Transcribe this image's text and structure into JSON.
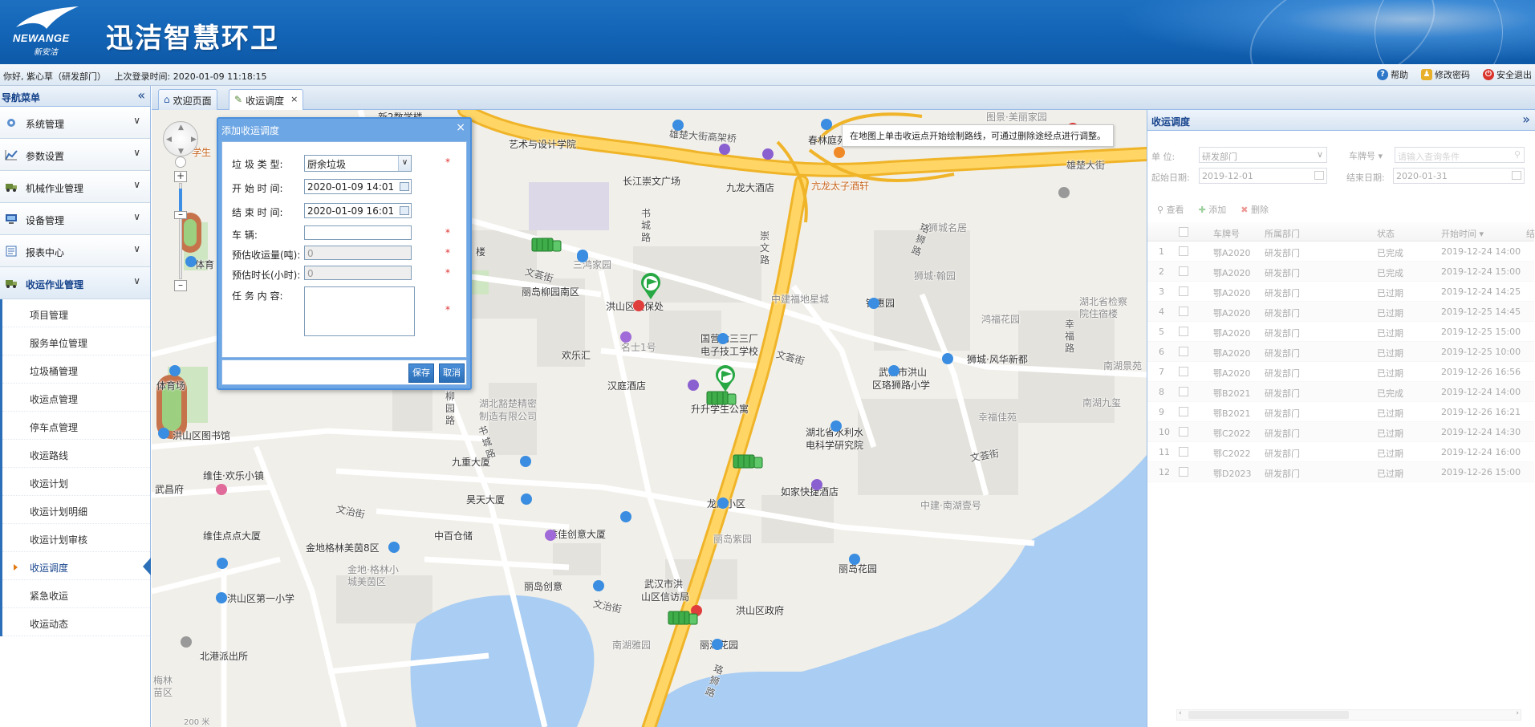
{
  "app": {
    "logo_en": "NEWANGE",
    "logo_cn": "新安洁",
    "title": "迅洁智慧环卫"
  },
  "infobar": {
    "welcome": "你好,",
    "user": "紫心草（研发部门）",
    "last_login_label": "上次登录时间:",
    "last_login_time": "2020-01-09 11:18:15",
    "help": "帮助",
    "change_password": "修改密码",
    "logout": "安全退出"
  },
  "sidebar": {
    "title": "导航菜单",
    "groups": [
      {
        "label": "系统管理",
        "icon": "gear-icon"
      },
      {
        "label": "参数设置",
        "icon": "chart-icon"
      },
      {
        "label": "机械作业管理",
        "icon": "truck-icon"
      },
      {
        "label": "设备管理",
        "icon": "monitor-icon"
      },
      {
        "label": "报表中心",
        "icon": "report-icon"
      },
      {
        "label": "收运作业管理",
        "icon": "truck-icon"
      }
    ],
    "subitems": [
      "项目管理",
      "服务单位管理",
      "垃圾桶管理",
      "收运点管理",
      "停车点管理",
      "收运路线",
      "收运计划",
      "收运计划明细",
      "收运计划审核",
      "收运调度",
      "紧急收运",
      "收运动态"
    ],
    "current_subitem": "收运调度"
  },
  "tabs": [
    {
      "label": "欢迎页面",
      "icon": "home-icon"
    },
    {
      "label": "收运调度",
      "icon": "dispatch-icon",
      "closable": true
    }
  ],
  "map": {
    "hint": "在地图上单击收运点开始绘制路线，可通过删除途经点进行调整。",
    "labels": {
      "l1": "新2数学楼",
      "l2": "艺术与设计学院",
      "l3": "雄楚大街高架桥",
      "l4": "春林庭苑",
      "l5": "长江崇文广场",
      "l6": "九龙大酒店",
      "l7": "亢龙太子酒轩",
      "l8": "雄楚大街",
      "l9": "学生",
      "l10": "书城路",
      "l11": "三鸿家园",
      "l12": "文荟街",
      "l13": "丽岛柳园南区",
      "l14": "洪山区社保处",
      "l15": "崇文路",
      "l16": "中建福地星城",
      "l17": "狮城名居",
      "l18": "狮城·翰园",
      "l19": "锦惠园",
      "l20": "鸿福花园",
      "l21": "湖北省检察院住宿楼",
      "l22": "幸福路",
      "l23": "欢乐汇",
      "l24": "名士1号",
      "l25": "国营七三三厂",
      "l26": "电子技工学校",
      "l27": "文荟街",
      "l28": "武汉市洪山",
      "l29": "区珞狮路小学",
      "l30": "狮城·风华新都",
      "l31": "汉庭酒店",
      "l32": "升升学生公寓",
      "l33": "湖北豁楚精密",
      "l34": "制造有限公司",
      "l35": "湖北省水利水",
      "l36": "电科学研究院",
      "l37": "南湖九玺",
      "l38": "幸福佳苑",
      "l39": "南湖景苑",
      "l40": "九重大厦",
      "l41": "昊天大厦",
      "l42": "龙威小区",
      "l43": "如家快捷酒店",
      "l44": "中建·南湖壹号",
      "l45": "文荟街",
      "l46": "洪山区图书馆",
      "l47": "维佳·欢乐小镇",
      "l48": "武昌府",
      "l49": "文治街",
      "l50": "维佳点点大厦",
      "l51": "金地格林美茵8区",
      "l52": "金地·格林小城美茵区",
      "l53": "中百仓储",
      "l54": "维佳创意大厦",
      "l55": "丽岛紫园",
      "l56": "丽岛花园",
      "l57": "洪山区第一小学",
      "l58": "丽岛创意",
      "l59": "武汉市洪",
      "l60": "山区信访局",
      "l61": "洪山区政府",
      "l62": "文治街",
      "l63": "南湖雅园",
      "l64": "丽湖花园",
      "l65": "北港派出所",
      "l66": "体育",
      "l67": "体育场",
      "l68": "柳园路",
      "l69": "书城路",
      "l70": "珞狮路",
      "l71": "珞狮路",
      "l72": "梅林苗区",
      "l73": "图景·美丽家园",
      "l74": "楼",
      "l75": "雄楚大街"
    }
  },
  "dialog": {
    "title": "添加收运调度",
    "fields": [
      {
        "label": "垃  圾  类  型:",
        "value": "厨余垃圾",
        "type": "select"
      },
      {
        "label": "开  始  时  间:",
        "value": "2020-01-09 14:01",
        "type": "date"
      },
      {
        "label": "结  束  时  间:",
        "value": "2020-01-09 16:01",
        "type": "date"
      },
      {
        "label": "车            辆:",
        "value": "",
        "type": "text"
      },
      {
        "label": "预估收运量(吨):",
        "value": "0",
        "type": "disabled"
      },
      {
        "label": "预估时长(小时):",
        "value": "0",
        "type": "disabled"
      },
      {
        "label": "任  务  内  容:",
        "value": "",
        "type": "textarea"
      }
    ],
    "required_mark": "*",
    "save": "保存",
    "cancel": "取消"
  },
  "rpanel": {
    "title": "收运调度",
    "dept_label": "单    位:",
    "dept_value": "研发部门",
    "plate_select": "车牌号",
    "plate_placeholder": "请输入查询条件",
    "start_label": "起始日期:",
    "start_value": "2019-12-01",
    "end_label": "结束日期:",
    "end_value": "2020-01-31",
    "tb_view": "查看",
    "tb_add": "添加",
    "tb_delete": "删除",
    "columns": [
      "车牌号",
      "所属部门",
      "状态",
      "开始时间"
    ],
    "col_extra": "结",
    "rows": [
      {
        "n": "1",
        "plate": "鄂A2020",
        "dept": "研发部门",
        "status": "已完成",
        "start": "2019-12-24 14:00"
      },
      {
        "n": "2",
        "plate": "鄂A2020",
        "dept": "研发部门",
        "status": "已完成",
        "start": "2019-12-24 15:00"
      },
      {
        "n": "3",
        "plate": "鄂A2020",
        "dept": "研发部门",
        "status": "已过期",
        "start": "2019-12-24 14:25"
      },
      {
        "n": "4",
        "plate": "鄂A2020",
        "dept": "研发部门",
        "status": "已过期",
        "start": "2019-12-25 14:45"
      },
      {
        "n": "5",
        "plate": "鄂A2020",
        "dept": "研发部门",
        "status": "已过期",
        "start": "2019-12-25 15:00"
      },
      {
        "n": "6",
        "plate": "鄂A2020",
        "dept": "研发部门",
        "status": "已过期",
        "start": "2019-12-25 10:00"
      },
      {
        "n": "7",
        "plate": "鄂A2020",
        "dept": "研发部门",
        "status": "已过期",
        "start": "2019-12-26 16:56"
      },
      {
        "n": "8",
        "plate": "鄂B2021",
        "dept": "研发部门",
        "status": "已完成",
        "start": "2019-12-24 14:00"
      },
      {
        "n": "9",
        "plate": "鄂B2021",
        "dept": "研发部门",
        "status": "已过期",
        "start": "2019-12-26 16:21"
      },
      {
        "n": "10",
        "plate": "鄂C2022",
        "dept": "研发部门",
        "status": "已过期",
        "start": "2019-12-24 14:30"
      },
      {
        "n": "11",
        "plate": "鄂C2022",
        "dept": "研发部门",
        "status": "已过期",
        "start": "2019-12-24 16:00"
      },
      {
        "n": "12",
        "plate": "鄂D2023",
        "dept": "研发部门",
        "status": "已过期",
        "start": "2019-12-26 15:00"
      }
    ]
  },
  "colors": {
    "banner": "#1466b8",
    "accent": "#15428b",
    "road_major": "#f5c342",
    "water": "#a9cdf3",
    "truck": "#3fae4a"
  }
}
